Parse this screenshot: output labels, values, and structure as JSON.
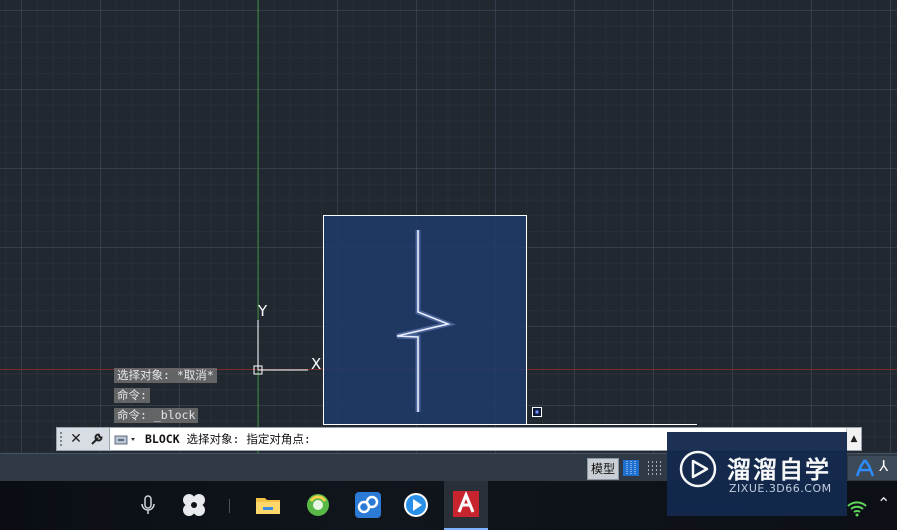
{
  "viewport": {
    "ucs": {
      "y_label": "Y",
      "x_label": "X"
    }
  },
  "command_history": [
    "选择对象: *取消*",
    "命令:",
    "命令: _block"
  ],
  "command_line": {
    "command_name": "BLOCK",
    "prompt": " 选择对象: 指定对角点:"
  },
  "status_bar": {
    "model_label": "模型"
  },
  "watermark": {
    "title": "溜溜自学",
    "subtitle": "ZIXUE.3D66.COM"
  },
  "taskbar": {
    "icons": [
      "microphone-icon",
      "pinwheel-icon",
      "file-explorer-icon",
      "browser-icon",
      "cloud-app-icon",
      "media-player-icon",
      "autocad-icon"
    ]
  },
  "colors": {
    "canvas_bg": "#212830",
    "selection_fill": "#1e3b6b",
    "axis_y": "#3a8a3a",
    "axis_x": "#8a3030",
    "accent": "#1e6fd0"
  }
}
